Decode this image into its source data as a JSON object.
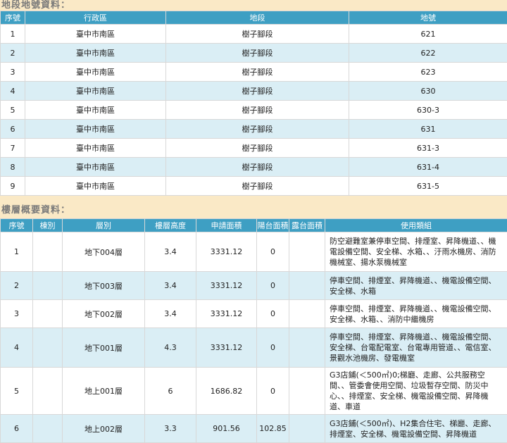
{
  "land": {
    "title": "地段地號資料：",
    "headers": [
      "序號",
      "行政區",
      "地段",
      "地號"
    ],
    "rows": [
      [
        "1",
        "臺中市南區",
        "樹子腳段",
        "621"
      ],
      [
        "2",
        "臺中市南區",
        "樹子腳段",
        "622"
      ],
      [
        "3",
        "臺中市南區",
        "樹子腳段",
        "623"
      ],
      [
        "4",
        "臺中市南區",
        "樹子腳段",
        "630"
      ],
      [
        "5",
        "臺中市南區",
        "樹子腳段",
        "630-3"
      ],
      [
        "6",
        "臺中市南區",
        "樹子腳段",
        "631"
      ],
      [
        "7",
        "臺中市南區",
        "樹子腳段",
        "631-3"
      ],
      [
        "8",
        "臺中市南區",
        "樹子腳段",
        "631-4"
      ],
      [
        "9",
        "臺中市南區",
        "樹子腳段",
        "631-5"
      ]
    ]
  },
  "floors": {
    "title": "樓層概要資料：",
    "headers": [
      "序號",
      "棟別",
      "層別",
      "樓層高度",
      "申請面積",
      "陽台面積",
      "露台面積",
      "使用類組"
    ],
    "rows": [
      [
        "1",
        "",
        "地下004層",
        "3.4",
        "3331.12",
        "0",
        "",
        "防空避難室兼停車空間、排煙室、昇降機道、、機電設備空間、安全梯、水箱、、汙雨水機房、消防機械室、揚水泵機械室"
      ],
      [
        "2",
        "",
        "地下003層",
        "3.4",
        "3331.12",
        "0",
        "",
        "停車空間、排煙室、昇降機道、、機電設備空間、安全梯、水箱"
      ],
      [
        "3",
        "",
        "地下002層",
        "3.4",
        "3331.12",
        "0",
        "",
        "停車空間、排煙室、昇降機道、、機電設備空間、安全梯、水箱、、消防中繼機房"
      ],
      [
        "4",
        "",
        "地下001層",
        "4.3",
        "3331.12",
        "0",
        "",
        "停車空間、排煙室、昇降機道、、機電設備空間、安全梯、台電配電室、台電專用管道、、電信室、景觀水池機房、發電機室"
      ],
      [
        "5",
        "",
        "地上001層",
        "6",
        "1686.82",
        "0",
        "",
        "G3店鋪(＜500㎡)0;梯廳、走廊、公共服務空間、、管委會使用空間、垃圾暫存空間、防災中心、、排煙室、安全梯、機電設備空間、昇降機道、車道"
      ],
      [
        "6",
        "",
        "地上002層",
        "3.3",
        "901.56",
        "102.85",
        "",
        "G3店鋪(＜500㎡)、H2集合住宅、梯廳、走廊、排煙室、安全梯、機電設備空間、昇降機道"
      ]
    ]
  }
}
